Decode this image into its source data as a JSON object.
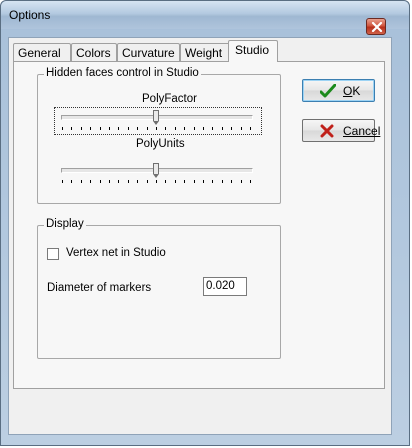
{
  "window": {
    "title": "Options"
  },
  "tabs": [
    {
      "label": "General"
    },
    {
      "label": "Colors"
    },
    {
      "label": "Curvature"
    },
    {
      "label": "Weight"
    },
    {
      "label": "Studio",
      "active": true
    }
  ],
  "hidden_faces": {
    "legend": "Hidden faces control in Studio",
    "poly_factor": {
      "label": "PolyFactor",
      "value_fraction": 0.5
    },
    "poly_units": {
      "label": "PolyUnits",
      "value_fraction": 0.5
    }
  },
  "display": {
    "legend": "Display",
    "vertex_net": {
      "label": "Vertex net in Studio",
      "checked": false
    },
    "diameter": {
      "label": "Diameter of markers",
      "value": "0.020"
    }
  },
  "buttons": {
    "ok_prefix": "",
    "ok_mnemonic": "O",
    "ok_rest": "K",
    "cancel_label": "Cancel"
  },
  "colors": {
    "ok_check": "#1c8a1c",
    "cancel_x": "#c0201a"
  },
  "icons": {
    "close": "close-icon",
    "ok": "checkmark-icon",
    "cancel": "x-mark-icon"
  }
}
